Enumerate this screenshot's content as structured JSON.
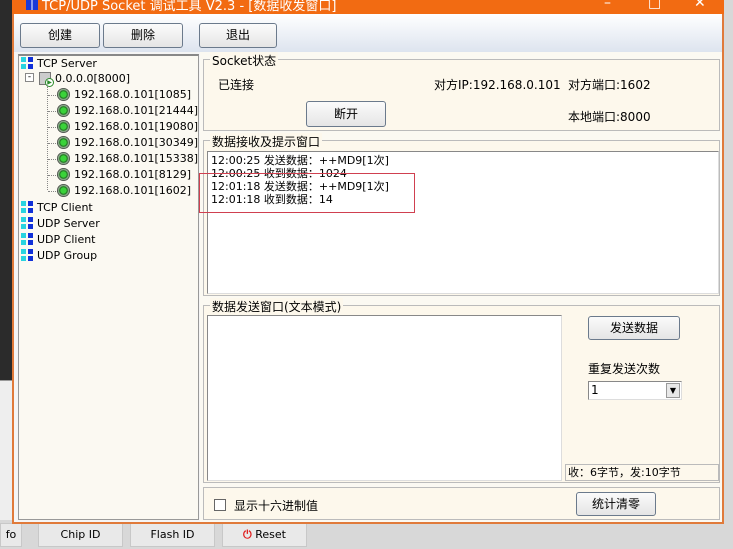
{
  "window": {
    "title": "TCP/UDP Socket 调试工具 V2.3 - [数据收发窗口]",
    "minimize": "–",
    "maximize": "□",
    "close": "✕"
  },
  "toolbar": {
    "create": "创建",
    "delete": "删除",
    "exit": "退出"
  },
  "tree": {
    "tcp_server": "TCP Server",
    "listener": "0.0.0.0[8000]",
    "connections": [
      "192.168.0.101[1085]",
      "192.168.0.101[21444]",
      "192.168.0.101[19080]",
      "192.168.0.101[30349]",
      "192.168.0.101[15338]",
      "192.168.0.101[8129]",
      "192.168.0.101[1602]"
    ],
    "tcp_client": "TCP Client",
    "udp_server": "UDP Server",
    "udp_client": "UDP Client",
    "udp_group": "UDP Group"
  },
  "socket_status": {
    "legend": "Socket状态",
    "state": "已连接",
    "peer_ip": "对方IP:192.168.0.101",
    "peer_port": "对方端口:1602",
    "disconnect": "断开",
    "local_port": "本地端口:8000"
  },
  "receive": {
    "legend": "数据接收及提示窗口",
    "lines": [
      "12:00:25 发送数据：++MD9[1次]",
      "12:00:25 收到数据：1024",
      "12:01:18 发送数据：++MD9[1次]",
      "12:01:18 收到数据：14"
    ]
  },
  "send": {
    "legend": "数据发送窗口(文本模式)",
    "input": "",
    "send_button": "发送数据",
    "repeat_label": "重复发送次数",
    "repeat_value": "1",
    "stats": "收：6字节，发:10字节"
  },
  "footer": {
    "hex_label": "显示十六进制值",
    "reset_stats": "统计清零"
  },
  "background_app": {
    "info": "fo",
    "chip_id": "Chip ID",
    "flash_id": "Flash ID",
    "reset": "Reset"
  }
}
